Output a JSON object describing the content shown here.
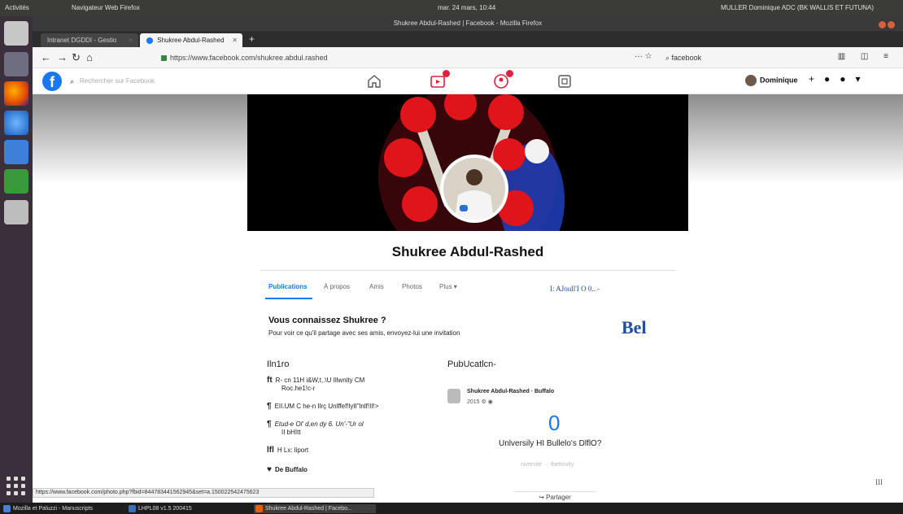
{
  "system": {
    "activities": "Activités",
    "window_menu": "Navigateur Web Firefox",
    "clock": "mar. 24 mars, 10:44",
    "user_menu": "MULLER Dominique ADC (BK WALLIS ET FUTUNA)"
  },
  "browser": {
    "window_title": "Shukree Abdul-Rashed | Facebook - Mozilla Firefox",
    "tabs": [
      {
        "label": "Intranet DGDDI - Gestio"
      },
      {
        "label": "Shukree Abdul-Rashed"
      }
    ],
    "url": "https://www.facebook.com/shukree.abdul.rashed",
    "search_value": "facebook",
    "status_url": "https://www.facebook.com/photo.php?fbid=844783441562945&set=a.150022542475623"
  },
  "facebook": {
    "search_placeholder": "Rechercher sur Facebook",
    "user_name": "Dominique",
    "profile_name": "Shukree Abdul-Rashed",
    "tabs": [
      "Publications",
      "À propos",
      "Amis",
      "Photos",
      "Plus ▾"
    ],
    "add_friend_text": "I: AJoull'I O 0..  -",
    "know_title": "Vous connaissez Shukree ?",
    "know_text": "Pour voir ce qu'il partage avec ses amis, envoyez-lui une invitation",
    "bel": "Bel",
    "intro_heading": "Iln1ro",
    "intro_rows": [
      {
        "icon": "ft",
        "line1": "R- cn 11H i&W,t,.\\U Illwnity CM",
        "line2": "Roc.he1!c-r"
      },
      {
        "icon": "¶",
        "line1": "EII.UM C he-n Ilrç Unlffef!lyII\"lnlf!II!>",
        "line2": ""
      },
      {
        "icon": "¶",
        "line1": "Etud-e Ol' d,en dy 6. Un'-\"Ur ol",
        "line2": "II bHItt"
      },
      {
        "icon": "lfl",
        "line1": "H Lx: liport",
        "line2": ""
      },
      {
        "icon": "♥",
        "line1": "De Buffalo",
        "line2": ""
      }
    ],
    "publications_heading": "PubUcatlcn-",
    "post_author": "Shukree Abdul-Rashed",
    "post_location": "Buffalo",
    "post_date": "2015",
    "zero": "0",
    "university_line": "Unlversily HI Bullelo's DlflO?",
    "faint_text": "niversité ··· thettriulty",
    "share": "Partager",
    "corner_mark": "III"
  },
  "taskbar": [
    {
      "label": "Mozilla et Paluzzi - Manuscripts",
      "color": "#4a7fd6"
    },
    {
      "label": "LHPL08 v1.5 200415",
      "color": "#3a6fb6"
    },
    {
      "label": "Shukree Abdul-Rashed | Facebo...",
      "color": "#e66000"
    }
  ],
  "colors": {
    "facebook_blue": "#1877f2",
    "notification_red": "#e41e3f",
    "link_blue": "#1b4fa0"
  }
}
